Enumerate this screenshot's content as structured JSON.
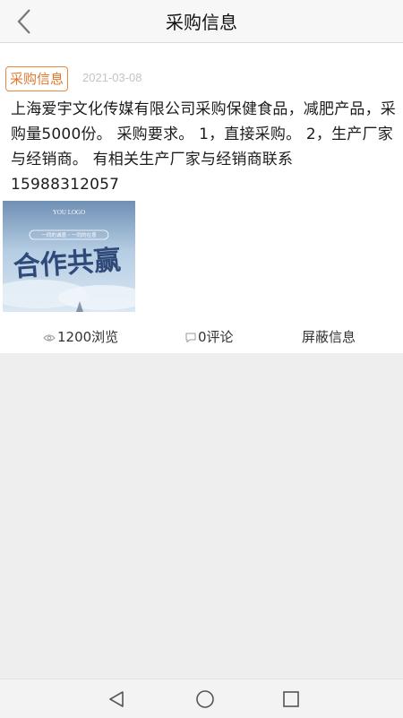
{
  "header": {
    "title": "采购信息",
    "back_icon": "back-chevron-icon"
  },
  "post": {
    "tag": "采购信息",
    "date": "2021-03-08",
    "description": "上海爱宇文化传媒有限公司采购保健食品，减肥产品，采购量5000份。 采购要求。 1，直接采购。 2，生产厂家与经销商。 有相关生产厂家与经销商联系15988312057",
    "image": {
      "logo_text": "YOU LOGO",
      "banner_text": "一同的诚意・一同的在意",
      "main_text": "合作共赢"
    }
  },
  "stats": {
    "views": "1200浏览",
    "comments": "0评论",
    "block": "屏蔽信息"
  },
  "colors": {
    "tag": "#e6863f",
    "background": "#eeeeef",
    "card": "#ffffff"
  },
  "navigation_bar": {
    "icons": [
      "back-triangle-icon",
      "home-circle-icon",
      "recents-square-icon"
    ]
  }
}
